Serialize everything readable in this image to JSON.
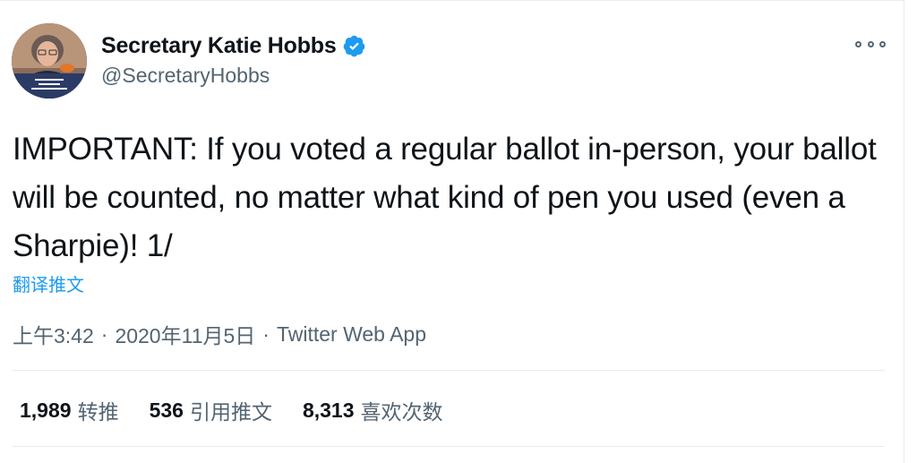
{
  "author": {
    "display_name": "Secretary Katie Hobbs",
    "handle": "@SecretaryHobbs",
    "verified": true,
    "avatar_caption": "Secretary of State Katie Hobbs #TrustedInfo2020"
  },
  "tweet": {
    "text": "IMPORTANT: If you voted a regular ballot in-person, your ballot will be counted, no matter what kind of pen you used (even a Sharpie)!  1/",
    "translate_label": "翻译推文"
  },
  "meta": {
    "time": "上午3:42",
    "separator": "·",
    "date": "2020年11月5日",
    "source": "Twitter Web App"
  },
  "stats": {
    "retweets_count": "1,989",
    "retweets_label": "转推",
    "quotes_count": "536",
    "quotes_label": "引用推文",
    "likes_count": "8,313",
    "likes_label": "喜欢次数"
  },
  "colors": {
    "link_blue": "#1d9bf0",
    "secondary_text": "#536471",
    "primary_text": "#0f1419"
  },
  "icons": {
    "verified": "verified-badge-icon",
    "more": "more-options-icon"
  }
}
